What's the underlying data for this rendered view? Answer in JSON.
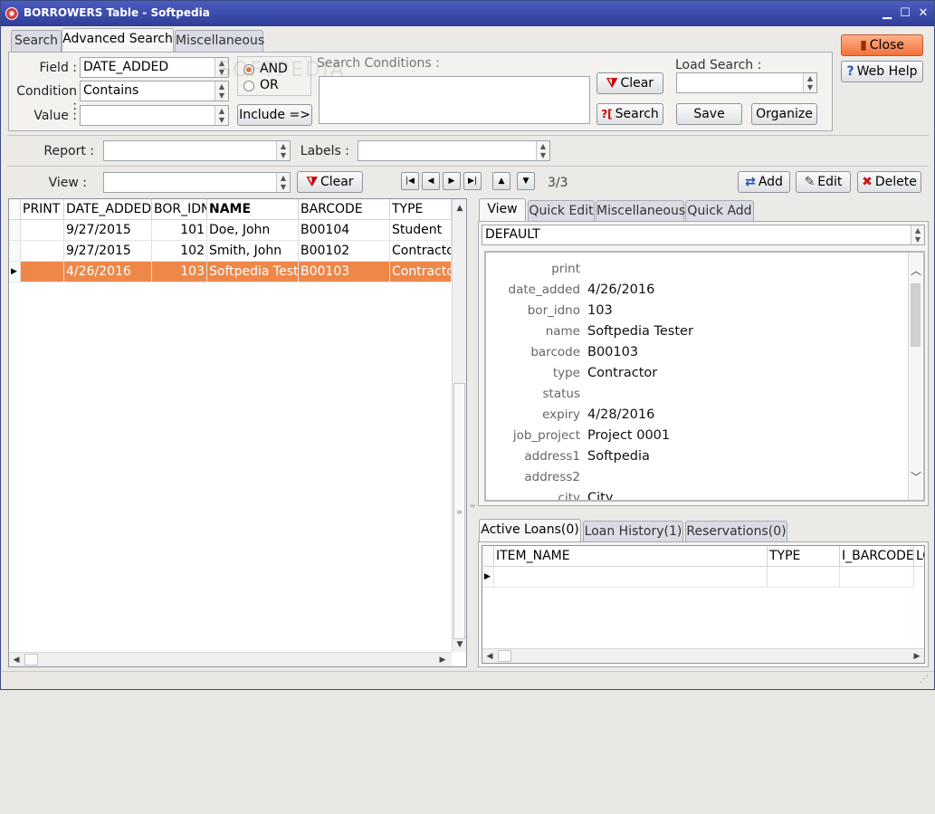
{
  "window": {
    "title": "BORROWERS Table - Softpedia",
    "app_icon": "app-logo-icon"
  },
  "top_tabs": [
    "Search",
    "Advanced Search",
    "Miscellaneous"
  ],
  "adv": {
    "field_label": "Field :",
    "field_value": "DATE_ADDED",
    "condition_label": "Condition :",
    "condition_value": "Contains",
    "value_label": "Value :",
    "value_value": "",
    "and_label": "AND",
    "or_label": "OR",
    "include_label": "Include =>",
    "search_conditions_label": "Search Conditions :",
    "clear_label": "Clear",
    "search_label": "Search",
    "load_search_label": "Load Search :",
    "load_search_value": "",
    "save_label": "Save",
    "organize_label": "Organize"
  },
  "side_buttons": {
    "close_label": "Close",
    "web_help_label": "Web Help"
  },
  "report_row": {
    "report_label": "Report :",
    "labels_label": "Labels :"
  },
  "view_row": {
    "view_label": "View :",
    "clear_label": "Clear",
    "record_counter": "3/3",
    "add_label": "Add",
    "edit_label": "Edit",
    "delete_label": "Delete"
  },
  "grid": {
    "columns": [
      "PRINT",
      "DATE_ADDED",
      "BOR_IDNO",
      "NAME",
      "BARCODE",
      "TYPE"
    ],
    "rows": [
      {
        "print": "",
        "date_added": "9/27/2015",
        "bor_idno": "101",
        "name": "Doe, John",
        "barcode": "B00104",
        "type": "Student"
      },
      {
        "print": "",
        "date_added": "9/27/2015",
        "bor_idno": "102",
        "name": "Smith, John",
        "barcode": "B00102",
        "type": "Contractor"
      },
      {
        "print": "",
        "date_added": "4/26/2016",
        "bor_idno": "103",
        "name": "Softpedia Tester",
        "barcode": "B00103",
        "type": "Contractor"
      }
    ]
  },
  "detail_tabs": [
    "View",
    "Quick Edit",
    "Miscellaneous",
    "Quick Add"
  ],
  "detail_view_select": "DEFAULT",
  "detail": {
    "fields": [
      {
        "k": "print",
        "v": ""
      },
      {
        "k": "date_added",
        "v": "4/26/2016"
      },
      {
        "k": "bor_idno",
        "v": "103"
      },
      {
        "k": "name",
        "v": "Softpedia Tester"
      },
      {
        "k": "barcode",
        "v": "B00103"
      },
      {
        "k": "type",
        "v": "Contractor"
      },
      {
        "k": "status",
        "v": ""
      },
      {
        "k": "expiry",
        "v": "4/28/2016"
      },
      {
        "k": "job_project",
        "v": "Project 0001"
      },
      {
        "k": "address1",
        "v": "Softpedia"
      },
      {
        "k": "address2",
        "v": ""
      },
      {
        "k": "city",
        "v": "City"
      }
    ]
  },
  "loan_tabs": [
    "Active Loans(0)",
    "Loan History(1)",
    "Reservations(0)"
  ],
  "loan_grid": {
    "columns": [
      "ITEM_NAME",
      "TYPE",
      "I_BARCODE",
      "LO"
    ]
  },
  "watermark": "SOFTPEDIA"
}
